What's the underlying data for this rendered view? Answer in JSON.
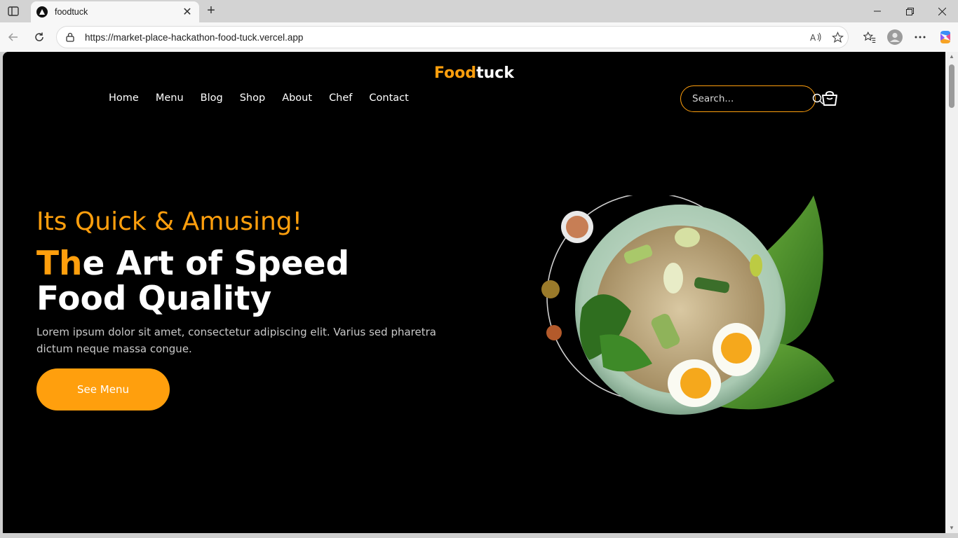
{
  "browser": {
    "tab_title": "foodtuck",
    "url": "https://market-place-hackathon-food-tuck.vercel.app",
    "tab_close": "✕",
    "new_tab": "+"
  },
  "site": {
    "logo_part1": "Food",
    "logo_part2": "tuck",
    "nav": [
      "Home",
      "Menu",
      "Blog",
      "Shop",
      "About",
      "Chef",
      "Contact"
    ],
    "search_placeholder": "Search...",
    "hero": {
      "tagline": "Its Quick & Amusing!",
      "headline_highlight": "Th",
      "headline_rest": "e Art of Speed",
      "headline_line2": "Food Quality",
      "description": "Lorem ipsum dolor sit amet, consectetur adipiscing elit. Varius sed pharetra dictum neque massa congue.",
      "cta": "See Menu"
    }
  },
  "colors": {
    "accent": "#FF9F0D",
    "page_bg": "#000000"
  }
}
